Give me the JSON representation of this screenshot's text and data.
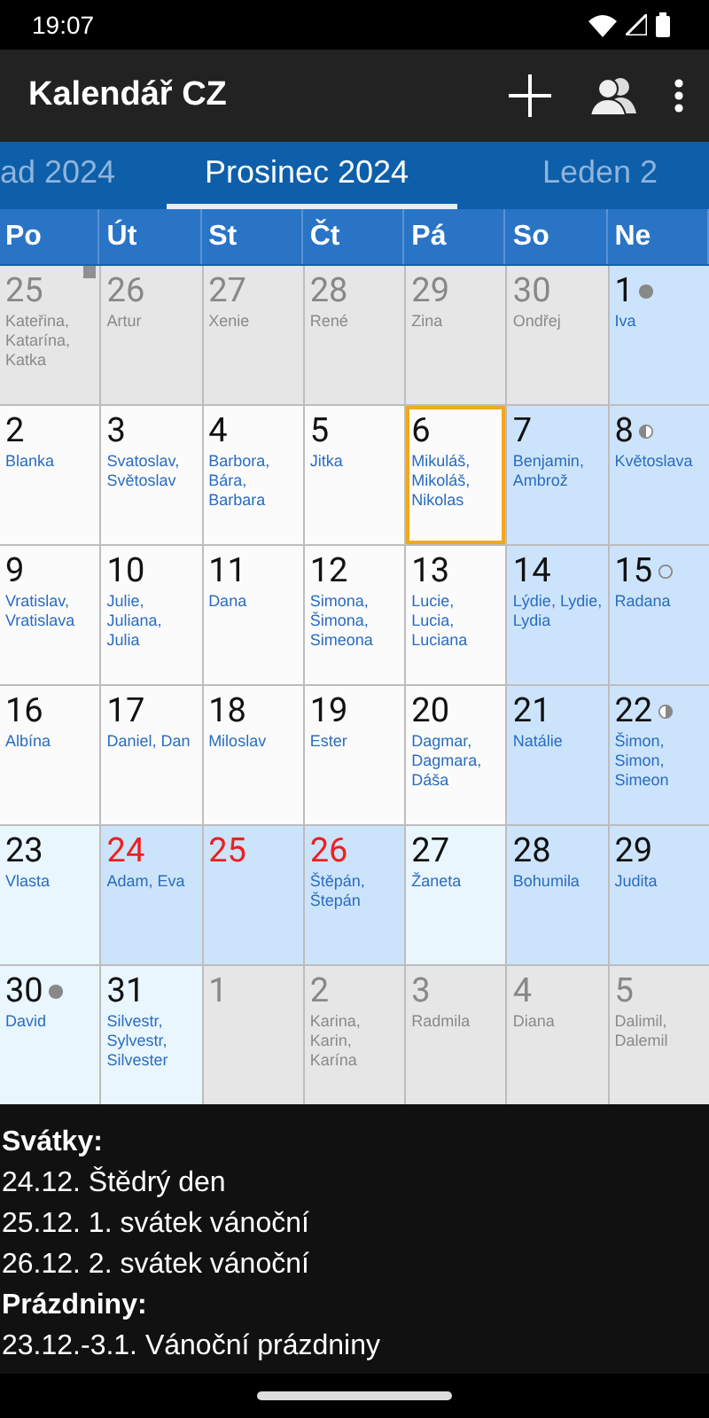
{
  "status_bar": {
    "time": "19:07"
  },
  "app_bar": {
    "title": "Kalendář CZ"
  },
  "months": [
    {
      "label": "ad 2024",
      "selected": false
    },
    {
      "label": "Prosinec 2024",
      "selected": true
    },
    {
      "label": "Leden 2",
      "selected": false
    }
  ],
  "weekdays": [
    "Po",
    "Út",
    "St",
    "Čt",
    "Pá",
    "So",
    "Ne"
  ],
  "days": [
    {
      "date": "25",
      "names": "Kateřina, Katarína, Katka",
      "kind": "other",
      "marker": true
    },
    {
      "date": "26",
      "names": "Artur",
      "kind": "other"
    },
    {
      "date": "27",
      "names": "Xenie",
      "kind": "other"
    },
    {
      "date": "28",
      "names": "René",
      "kind": "other"
    },
    {
      "date": "29",
      "names": "Zina",
      "kind": "other"
    },
    {
      "date": "30",
      "names": "Ondřej",
      "kind": "other"
    },
    {
      "date": "1",
      "names": "Iva",
      "kind": "weekend",
      "moon": {
        "kind": "new"
      }
    },
    {
      "date": "2",
      "names": "Blanka",
      "kind": "workday"
    },
    {
      "date": "3",
      "names": "Svatoslav, Světoslav",
      "kind": "workday"
    },
    {
      "date": "4",
      "names": "Barbora, Bára, Barbara",
      "kind": "workday"
    },
    {
      "date": "5",
      "names": "Jitka",
      "kind": "workday"
    },
    {
      "date": "6",
      "names": "Mikuláš, Mikoláš, Nikolas",
      "kind": "workday",
      "today": true
    },
    {
      "date": "7",
      "names": "Benjamin, Ambrož",
      "kind": "weekend"
    },
    {
      "date": "8",
      "names": "Květoslava",
      "kind": "weekend",
      "moon": {
        "kind": "first_quarter"
      }
    },
    {
      "date": "9",
      "names": "Vratislav, Vratislava",
      "kind": "workday"
    },
    {
      "date": "10",
      "names": "Julie, Juliana, Julia",
      "kind": "workday"
    },
    {
      "date": "11",
      "names": "Dana",
      "kind": "workday"
    },
    {
      "date": "12",
      "names": "Simona, Šimona, Simeona",
      "kind": "workday"
    },
    {
      "date": "13",
      "names": "Lucie, Lucia, Luciana",
      "kind": "workday"
    },
    {
      "date": "14",
      "names": "Lýdie, Lydie, Lydia",
      "kind": "weekend"
    },
    {
      "date": "15",
      "names": "Radana",
      "kind": "weekend",
      "moon": {
        "kind": "full"
      }
    },
    {
      "date": "16",
      "names": "Albína",
      "kind": "workday"
    },
    {
      "date": "17",
      "names": "Daniel, Dan",
      "kind": "workday"
    },
    {
      "date": "18",
      "names": "Miloslav",
      "kind": "workday"
    },
    {
      "date": "19",
      "names": "Ester",
      "kind": "workday"
    },
    {
      "date": "20",
      "names": "Dagmar, Dagmara, Dáša",
      "kind": "workday"
    },
    {
      "date": "21",
      "names": "Natálie",
      "kind": "weekend"
    },
    {
      "date": "22",
      "names": "Šimon, Simon, Simeon",
      "kind": "weekend",
      "moon": {
        "kind": "last_quarter"
      }
    },
    {
      "date": "23",
      "names": "Vlasta",
      "kind": "vacation"
    },
    {
      "date": "24",
      "names": "Adam, Eva",
      "kind": "weekend",
      "public_holiday": true
    },
    {
      "date": "25",
      "kind": "weekend",
      "public_holiday": true
    },
    {
      "date": "26",
      "names": "Štěpán, Štepán",
      "kind": "weekend",
      "public_holiday": true
    },
    {
      "date": "27",
      "names": "Žaneta",
      "kind": "vacation"
    },
    {
      "date": "28",
      "names": "Bohumila",
      "kind": "weekend"
    },
    {
      "date": "29",
      "names": "Judita",
      "kind": "weekend"
    },
    {
      "date": "30",
      "names": "David",
      "kind": "vacation",
      "moon": {
        "kind": "new"
      }
    },
    {
      "date": "31",
      "names": "Silvestr, Sylvestr, Silvester",
      "kind": "vacation"
    },
    {
      "date": "1",
      "kind": "other"
    },
    {
      "date": "2",
      "names": "Karina, Karin, Karína",
      "kind": "other"
    },
    {
      "date": "3",
      "names": "Radmila",
      "kind": "other"
    },
    {
      "date": "4",
      "names": "Diana",
      "kind": "other"
    },
    {
      "date": "5",
      "names": "Dalimil, Dalemil",
      "kind": "other"
    }
  ],
  "info": [
    {
      "kind": "heading",
      "text": "Svátky:"
    },
    {
      "kind": "line",
      "text": "24.12. Štědrý den"
    },
    {
      "kind": "line",
      "text": "25.12. 1. svátek vánoční"
    },
    {
      "kind": "line",
      "text": "26.12. 2. svátek vánoční"
    },
    {
      "kind": "heading",
      "text": "Prázdniny:"
    },
    {
      "kind": "line",
      "text": "23.12.-3.1. Vánoční prázdniny"
    }
  ]
}
